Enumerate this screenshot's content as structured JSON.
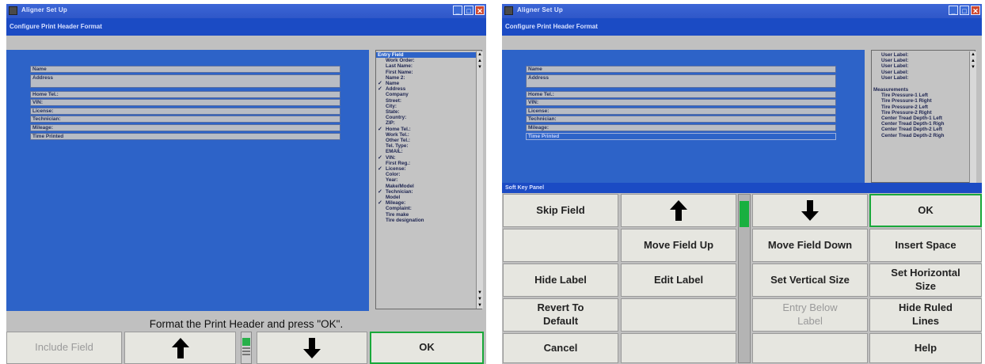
{
  "colors": {
    "accent_blue": "#2d63c8",
    "title_blue": "#1b4bc4",
    "ok_green": "#19a83a"
  },
  "left": {
    "window_title": "Aligner Set Up",
    "subtitle": "Configure Print Header Format",
    "fields": [
      "Name",
      "Address",
      "Home Tel.:",
      "VIN:",
      "License:",
      "Technician:",
      "Mileage:",
      "Time Printed"
    ],
    "entry_header": "Entry Field",
    "entries": [
      {
        "label": "Work Order:",
        "checked": false
      },
      {
        "label": "Last Name:",
        "checked": false
      },
      {
        "label": "First Name:",
        "checked": false
      },
      {
        "label": "Name 2:",
        "checked": false
      },
      {
        "label": "Name",
        "checked": true
      },
      {
        "label": "Address",
        "checked": true
      },
      {
        "label": "Company",
        "checked": false
      },
      {
        "label": "Street:",
        "checked": false
      },
      {
        "label": "City:",
        "checked": false
      },
      {
        "label": "State:",
        "checked": false
      },
      {
        "label": "Country:",
        "checked": false
      },
      {
        "label": "ZIP:",
        "checked": false
      },
      {
        "label": "Home Tel.:",
        "checked": true
      },
      {
        "label": "Work Tel.:",
        "checked": false
      },
      {
        "label": "Other Tel.:",
        "checked": false
      },
      {
        "label": "Tel. Type:",
        "checked": false
      },
      {
        "label": "EMAIL:",
        "checked": false
      },
      {
        "label": "VIN:",
        "checked": true
      },
      {
        "label": "First Reg.:",
        "checked": false
      },
      {
        "label": "License:",
        "checked": true
      },
      {
        "label": "Color:",
        "checked": false
      },
      {
        "label": "Year:",
        "checked": false
      },
      {
        "label": "Make/Model",
        "checked": false
      },
      {
        "label": "Technician:",
        "checked": true
      },
      {
        "label": "Model",
        "checked": false
      },
      {
        "label": "Mileage:",
        "checked": true
      },
      {
        "label": "Complaint:",
        "checked": false
      },
      {
        "label": "Tire make",
        "checked": false
      },
      {
        "label": "Tire designation",
        "checked": false
      }
    ],
    "instruction": "Format the Print Header and press \"OK\".",
    "buttons": {
      "include": "Include Field",
      "ok": "OK"
    },
    "check_glyph": "✓",
    "icons": {
      "up": "up-arrow-icon",
      "down": "down-arrow-icon"
    }
  },
  "right": {
    "window_title": "Aligner Set Up",
    "subtitle": "Configure Print Header Format",
    "fields": [
      "Name",
      "Address",
      "Home Tel.:",
      "VIN:",
      "License:",
      "Technician:",
      "Mileage:",
      "Time Printed"
    ],
    "entries_top": [
      "User Label:",
      "User Label:",
      "User Label:",
      "User Label:",
      "User Label:"
    ],
    "measurements_header": "Measurements",
    "measurements": [
      "Tire Pressure-1 Left",
      "Tire Pressure-1 Right",
      "Tire Pressure-2 Left",
      "Tire Pressure-2 Right",
      "Center Tread Depth-1 Left",
      "Center Tread Depth-1 Righ",
      "Center Tread Depth-2 Left",
      "Center Tread Depth-2 Righ"
    ],
    "softkey_title": "Soft Key Panel",
    "buttons": {
      "skip": "Skip Field",
      "ok": "OK",
      "move_up": "Move Field Up",
      "move_down": "Move Field Down",
      "insert_space": "Insert Space",
      "hide_label": "Hide Label",
      "edit_label": "Edit Label",
      "set_vertical": "Set Vertical Size",
      "set_horizontal": "Set Horizontal Size",
      "revert": "Revert To Default",
      "entry_below": "Entry Below Label",
      "hide_ruled": "Hide Ruled Lines",
      "cancel": "Cancel",
      "help": "Help"
    }
  }
}
